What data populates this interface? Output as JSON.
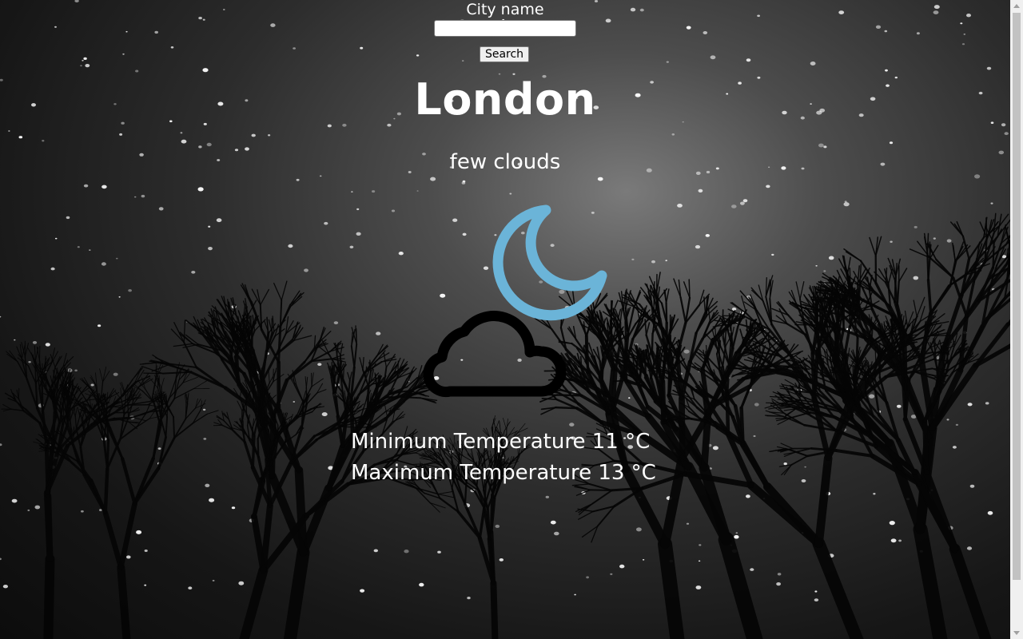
{
  "search": {
    "label": "City name",
    "input_value": "",
    "button_label": "Search"
  },
  "weather": {
    "city": "London",
    "description": "few clouds",
    "icon": "cloud-moon-icon",
    "min_temp_text": "Minimum Temperature 11 °C",
    "max_temp_text": "Maximum Temperature 13 °C"
  },
  "colors": {
    "text": "#ffffff",
    "moon": "#6bb4d8",
    "cloud": "#000000"
  }
}
